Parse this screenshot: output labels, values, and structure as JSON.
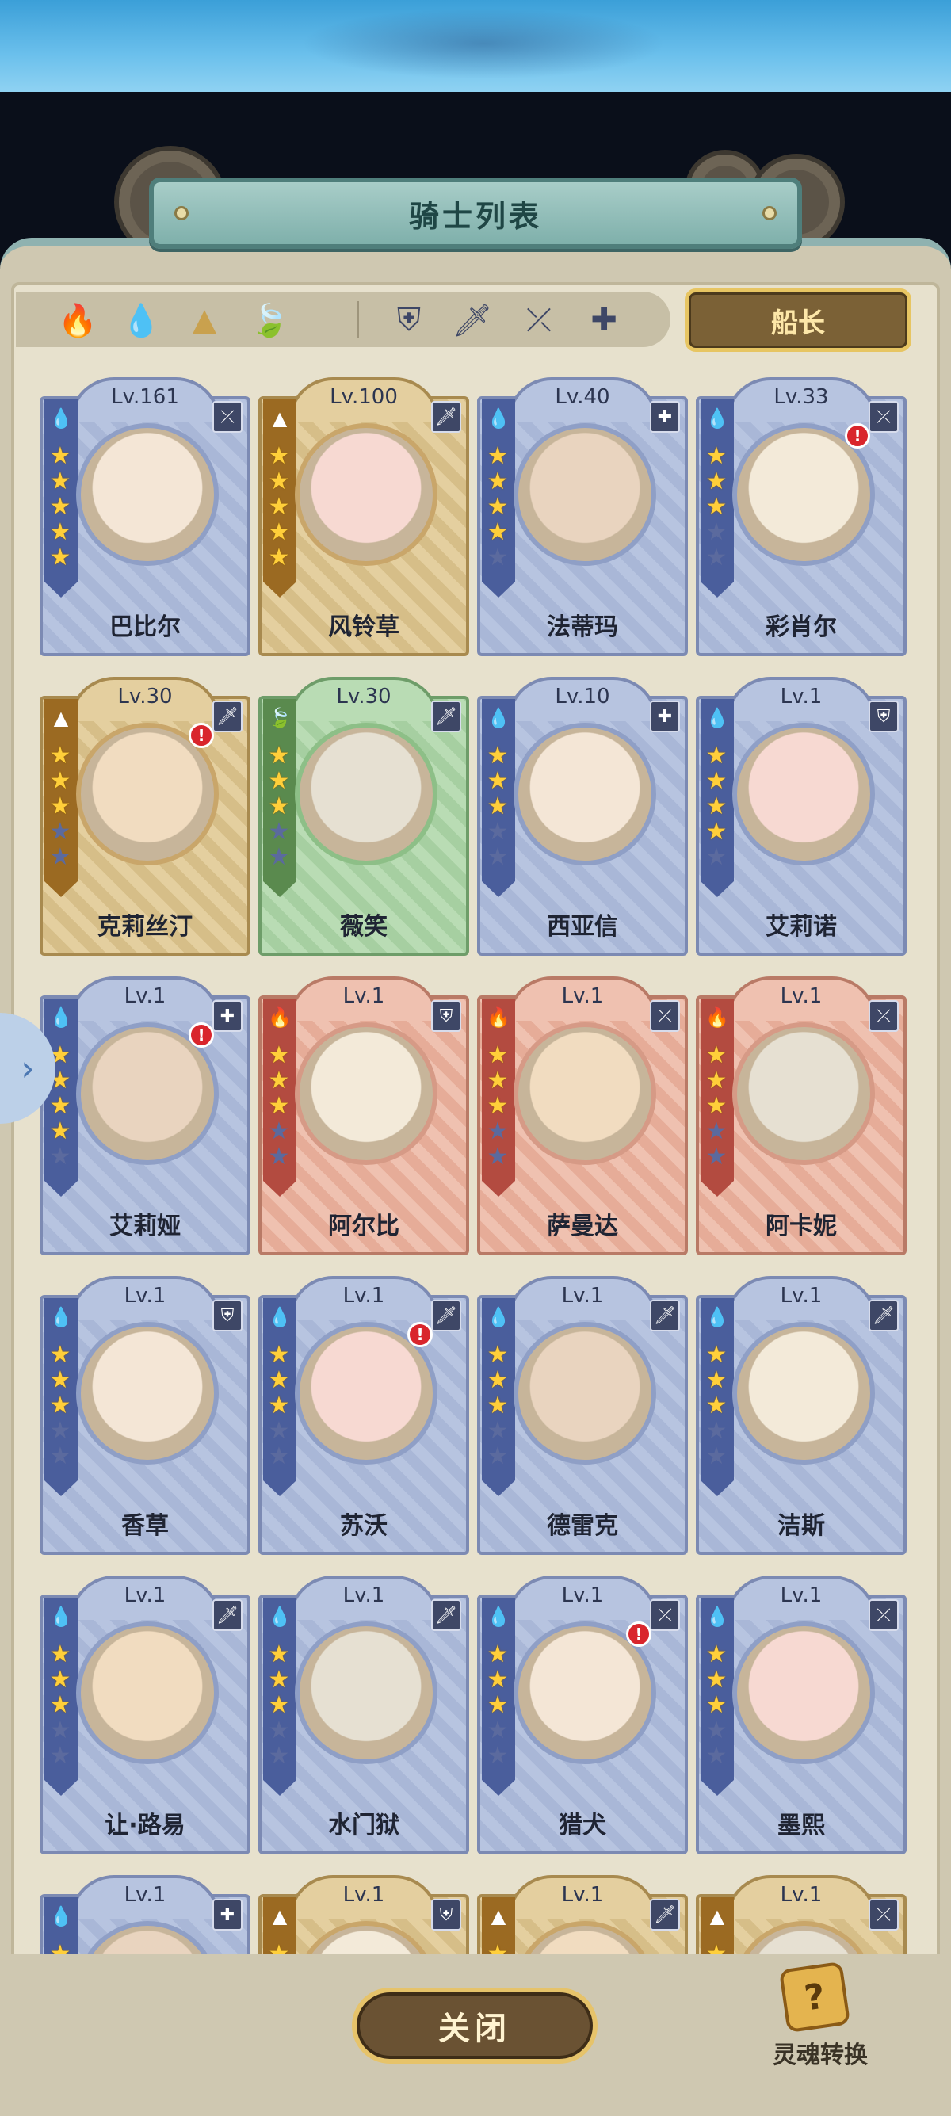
{
  "header": {
    "title": "骑士列表"
  },
  "filters": {
    "elements": [
      {
        "name": "fire",
        "icon": "🔥",
        "color": "#c64a3a"
      },
      {
        "name": "water",
        "icon": "💧",
        "color": "#4a7ac6"
      },
      {
        "name": "earth",
        "icon": "▲",
        "color": "#c9a14e"
      },
      {
        "name": "wind",
        "icon": "🍃",
        "color": "#6aa25a"
      }
    ],
    "classes": [
      {
        "name": "shield",
        "icon": "⛨"
      },
      {
        "name": "sword",
        "icon": "🗡"
      },
      {
        "name": "bow",
        "icon": "⤫"
      },
      {
        "name": "healer",
        "icon": "✚"
      }
    ]
  },
  "captain_button": "船长",
  "knights": [
    {
      "name": "巴比尔",
      "level": "Lv.161",
      "element": "water",
      "class": "bow",
      "stars": 5,
      "theme": "blue",
      "alert": false
    },
    {
      "name": "风铃草",
      "level": "Lv.100",
      "element": "earth",
      "class": "sword",
      "stars": 5,
      "theme": "gold",
      "alert": false
    },
    {
      "name": "法蒂玛",
      "level": "Lv.40",
      "element": "water",
      "class": "healer",
      "stars": 4,
      "theme": "blue",
      "alert": false
    },
    {
      "name": "彩肖尔",
      "level": "Lv.33",
      "element": "water",
      "class": "bow",
      "stars": 3,
      "theme": "blue",
      "alert": true
    },
    {
      "name": "克莉丝汀",
      "level": "Lv.30",
      "element": "earth",
      "class": "sword",
      "stars": 3,
      "theme": "gold",
      "alert": true
    },
    {
      "name": "薇笑",
      "level": "Lv.30",
      "element": "wind",
      "class": "sword",
      "stars": 3,
      "theme": "green",
      "alert": false
    },
    {
      "name": "西亚信",
      "level": "Lv.10",
      "element": "water",
      "class": "healer",
      "stars": 3,
      "theme": "blue",
      "alert": false
    },
    {
      "name": "艾莉诺",
      "level": "Lv.1",
      "element": "water",
      "class": "shield",
      "stars": 4,
      "theme": "blue",
      "alert": false
    },
    {
      "name": "艾莉娅",
      "level": "Lv.1",
      "element": "water",
      "class": "healer",
      "stars": 4,
      "theme": "blue",
      "alert": true
    },
    {
      "name": "阿尔比",
      "level": "Lv.1",
      "element": "fire",
      "class": "shield",
      "stars": 3,
      "theme": "red",
      "alert": false
    },
    {
      "name": "萨曼达",
      "level": "Lv.1",
      "element": "fire",
      "class": "bow",
      "stars": 3,
      "theme": "red",
      "alert": false
    },
    {
      "name": "阿卡妮",
      "level": "Lv.1",
      "element": "fire",
      "class": "bow",
      "stars": 3,
      "theme": "red",
      "alert": false
    },
    {
      "name": "香草",
      "level": "Lv.1",
      "element": "water",
      "class": "shield",
      "stars": 3,
      "theme": "blue",
      "alert": false
    },
    {
      "name": "苏沃",
      "level": "Lv.1",
      "element": "water",
      "class": "sword",
      "stars": 3,
      "theme": "blue",
      "alert": true
    },
    {
      "name": "德雷克",
      "level": "Lv.1",
      "element": "water",
      "class": "sword",
      "stars": 3,
      "theme": "blue",
      "alert": false
    },
    {
      "name": "洁斯",
      "level": "Lv.1",
      "element": "water",
      "class": "sword",
      "stars": 3,
      "theme": "blue",
      "alert": false
    },
    {
      "name": "让·路易",
      "level": "Lv.1",
      "element": "water",
      "class": "sword",
      "stars": 3,
      "theme": "blue",
      "alert": false
    },
    {
      "name": "水门狱",
      "level": "Lv.1",
      "element": "water",
      "class": "sword",
      "stars": 3,
      "theme": "blue",
      "alert": false
    },
    {
      "name": "猎犬",
      "level": "Lv.1",
      "element": "water",
      "class": "bow",
      "stars": 3,
      "theme": "blue",
      "alert": true
    },
    {
      "name": "墨熙",
      "level": "Lv.1",
      "element": "water",
      "class": "bow",
      "stars": 3,
      "theme": "blue",
      "alert": false
    },
    {
      "name": "",
      "level": "Lv.1",
      "element": "water",
      "class": "healer",
      "stars": 3,
      "theme": "blue",
      "alert": false
    },
    {
      "name": "",
      "level": "Lv.1",
      "element": "earth",
      "class": "shield",
      "stars": 3,
      "theme": "gold",
      "alert": false
    },
    {
      "name": "",
      "level": "Lv.1",
      "element": "earth",
      "class": "sword",
      "stars": 3,
      "theme": "gold",
      "alert": false
    },
    {
      "name": "",
      "level": "Lv.1",
      "element": "earth",
      "class": "bow",
      "stars": 3,
      "theme": "gold",
      "alert": false
    }
  ],
  "footer": {
    "close_button": "关闭",
    "soul_convert": "灵魂转换",
    "soul_icon": "?"
  },
  "side_tab_icon": "›"
}
